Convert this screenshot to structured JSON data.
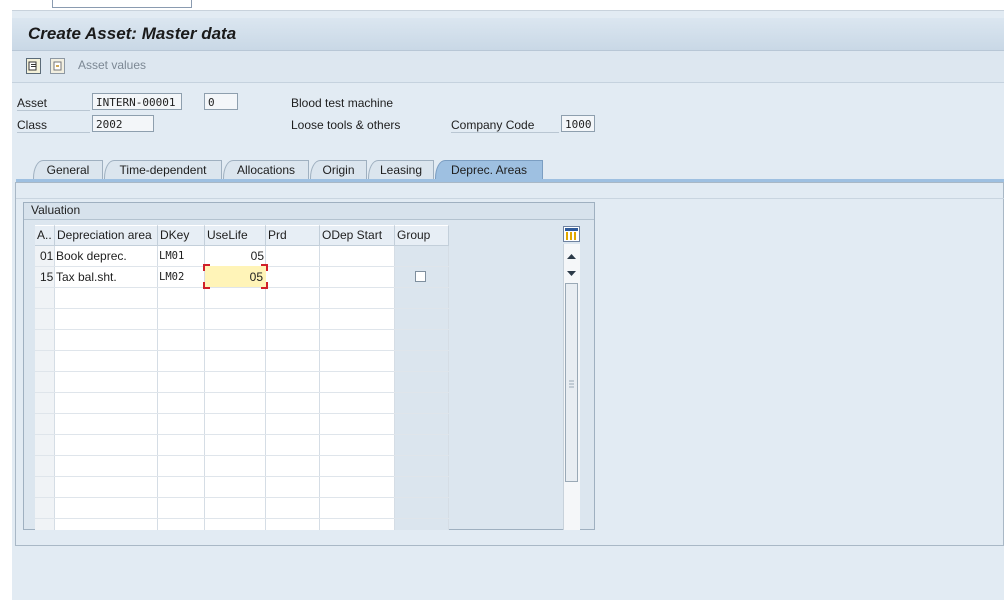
{
  "window": {
    "title": "Create Asset:  Master data"
  },
  "toolbar": {
    "asset_values_label": "Asset values"
  },
  "header": {
    "asset_label": "Asset",
    "asset_number": "INTERN-00001",
    "asset_subnumber": "0",
    "asset_description": "Blood test machine",
    "class_label": "Class",
    "class_value": "2002",
    "class_description": "Loose tools & others",
    "company_code_label": "Company Code",
    "company_code_value": "1000"
  },
  "tabs": [
    {
      "label": "General"
    },
    {
      "label": "Time-dependent"
    },
    {
      "label": "Allocations"
    },
    {
      "label": "Origin"
    },
    {
      "label": "Leasing"
    },
    {
      "label": "Deprec. Areas",
      "active": true
    }
  ],
  "valuation": {
    "title": "Valuation",
    "columns": [
      "A..",
      "Depreciation area",
      "DKey",
      "UseLife",
      "Prd",
      "ODep Start",
      "Group"
    ],
    "rows": [
      {
        "area_no": "01",
        "area": "Book deprec.",
        "dkey": "LM01",
        "uselife": "05",
        "prd": "",
        "odep_start": ""
      },
      {
        "area_no": "15",
        "area": "Tax bal.sht.",
        "dkey": "LM02",
        "uselife": "05",
        "prd": "",
        "odep_start": ""
      }
    ]
  },
  "colors": {
    "accent_tab": "#9ec0e1",
    "focus_cell": "#fff4b8"
  }
}
